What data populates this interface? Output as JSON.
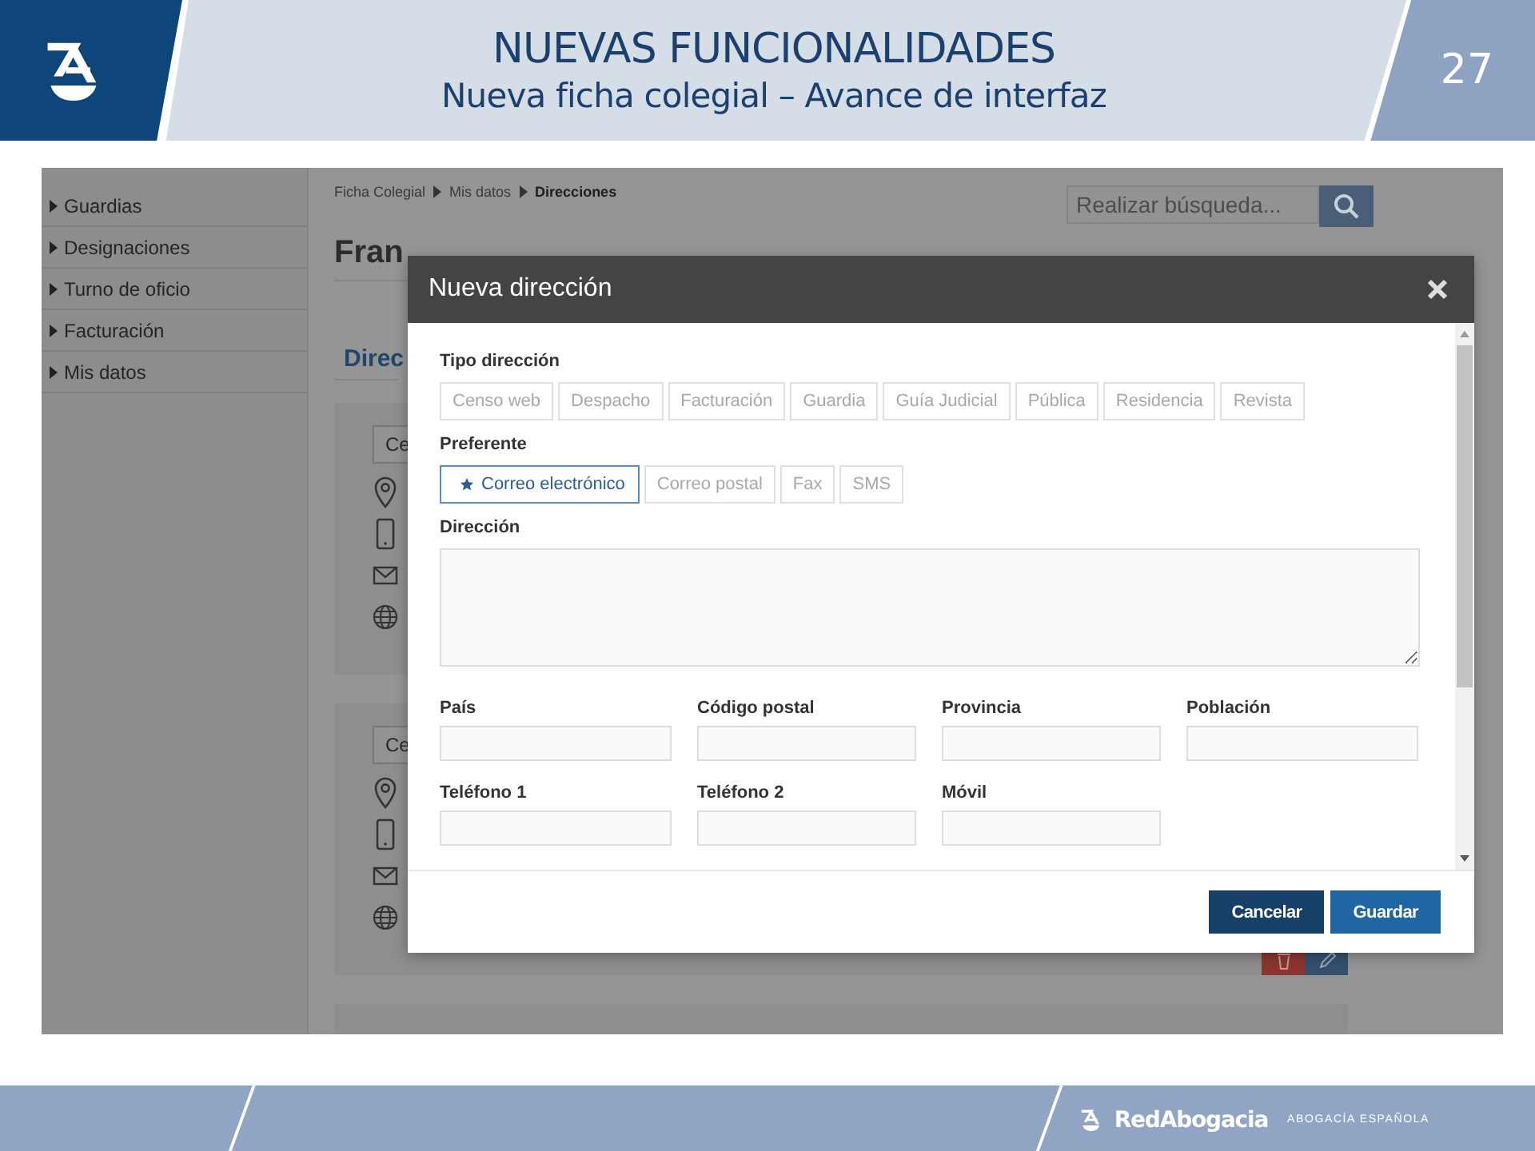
{
  "slide": {
    "title": "NUEVAS FUNCIONALIDADES",
    "subtitle": "Nueva ficha colegial – Avance de interfaz",
    "page_number": "27"
  },
  "app": {
    "sidebar": {
      "items": [
        {
          "label": "Guardias"
        },
        {
          "label": "Designaciones"
        },
        {
          "label": "Turno de oficio"
        },
        {
          "label": "Facturación"
        },
        {
          "label": "Mis datos"
        }
      ]
    },
    "breadcrumb": [
      {
        "label": "Ficha Colegial",
        "current": false
      },
      {
        "label": "Mis datos",
        "current": false
      },
      {
        "label": "Direcciones",
        "current": true
      }
    ],
    "search": {
      "placeholder": "Realizar búsqueda..."
    },
    "person_name": "Fran",
    "section_title": "Direc",
    "cards": [
      {
        "tag": "Ce"
      },
      {
        "tag": "Ce"
      }
    ]
  },
  "dialog": {
    "title": "Nueva dirección",
    "tipo_label": "Tipo dirección",
    "tipo_options": [
      {
        "label": "Censo web",
        "selected": false
      },
      {
        "label": "Despacho",
        "selected": false
      },
      {
        "label": "Facturación",
        "selected": false
      },
      {
        "label": "Guardia",
        "selected": false
      },
      {
        "label": "Guía Judicial",
        "selected": false
      },
      {
        "label": "Pública",
        "selected": false
      },
      {
        "label": "Residencia",
        "selected": false
      },
      {
        "label": "Revista",
        "selected": false
      }
    ],
    "preferente_label": "Preferente",
    "preferente_options": [
      {
        "label": "Correo electrónico",
        "selected": true
      },
      {
        "label": "Correo postal",
        "selected": false
      },
      {
        "label": "Fax",
        "selected": false
      },
      {
        "label": "SMS",
        "selected": false
      }
    ],
    "direccion_label": "Dirección",
    "fields": [
      {
        "label": "País"
      },
      {
        "label": "Código postal"
      },
      {
        "label": "Provincia"
      },
      {
        "label": "Población"
      },
      {
        "label": "Teléfono 1"
      },
      {
        "label": "Teléfono 2"
      },
      {
        "label": "Móvil"
      }
    ],
    "buttons": [
      {
        "label": "Cancelar",
        "kind": "secondary"
      },
      {
        "label": "Guardar",
        "kind": "primary"
      }
    ]
  },
  "footer": {
    "brand": "RedAbogacia",
    "tagline": "ABOGACÍA ESPAÑOLA"
  }
}
